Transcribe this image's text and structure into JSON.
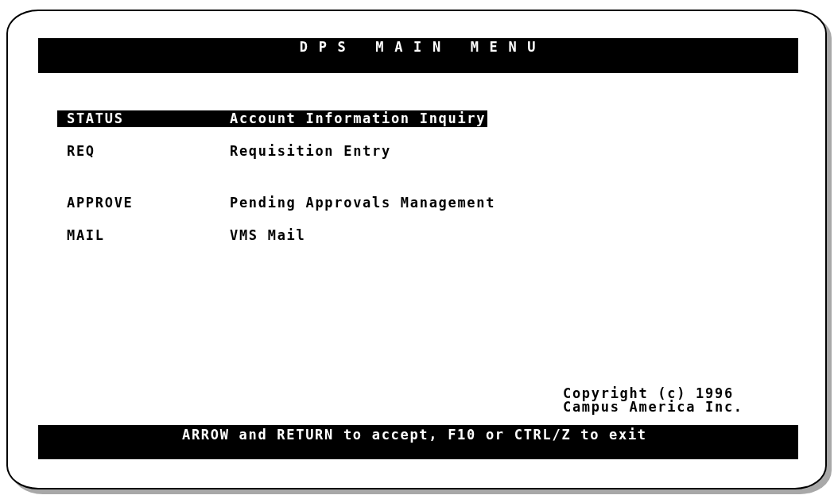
{
  "title": "D P S   M A I N   M E N U",
  "menu_groups": [
    [
      {
        "key": "STATUS",
        "description": "Account Information Inquiry",
        "selected": true
      },
      {
        "key": "REQ",
        "description": "Requisition Entry",
        "selected": false
      }
    ],
    [
      {
        "key": "APPROVE",
        "description": "Pending Approvals Management",
        "selected": false
      },
      {
        "key": "MAIL",
        "description": "VMS Mail",
        "selected": false
      }
    ]
  ],
  "copyright": [
    "Copyright (c) 1996",
    "Campus America Inc."
  ],
  "footer": "ARROW and RETURN to accept, F10 or CTRL/Z to exit"
}
